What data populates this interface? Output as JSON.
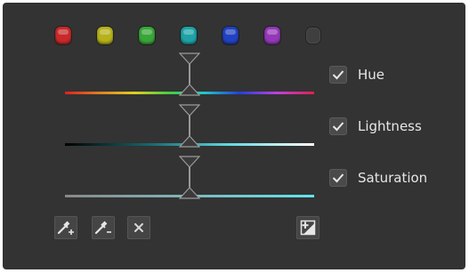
{
  "colors": {
    "panel_bg": "#333333",
    "text": "#e6e6e6"
  },
  "swatches": [
    {
      "name": "red",
      "color": "#c82a2a"
    },
    {
      "name": "yellow",
      "color": "#b6b21c"
    },
    {
      "name": "green",
      "color": "#3aa63a"
    },
    {
      "name": "cyan",
      "color": "#1ea2a6"
    },
    {
      "name": "blue",
      "color": "#2242c2"
    },
    {
      "name": "magenta",
      "color": "#9438b8"
    },
    {
      "name": "none",
      "color": "#3f3f3f"
    }
  ],
  "options": {
    "hue": {
      "label": "Hue",
      "checked": true
    },
    "lightness": {
      "label": "Lightness",
      "checked": true
    },
    "saturation": {
      "label": "Saturation",
      "checked": true
    }
  },
  "slider_markers": {
    "hue": 0.5,
    "lightness": 0.5,
    "saturation": 0.5
  },
  "toolbar": {
    "buttons": [
      {
        "name": "picker-add",
        "icon": "eyedropper-plus-icon",
        "symbol": "+"
      },
      {
        "name": "picker-subtract",
        "icon": "eyedropper-minus-icon",
        "symbol": "-"
      },
      {
        "name": "clear",
        "icon": "close-icon",
        "symbol": "×"
      },
      {
        "name": "display-mask",
        "icon": "mask-display-icon",
        "symbol": "+"
      }
    ]
  }
}
